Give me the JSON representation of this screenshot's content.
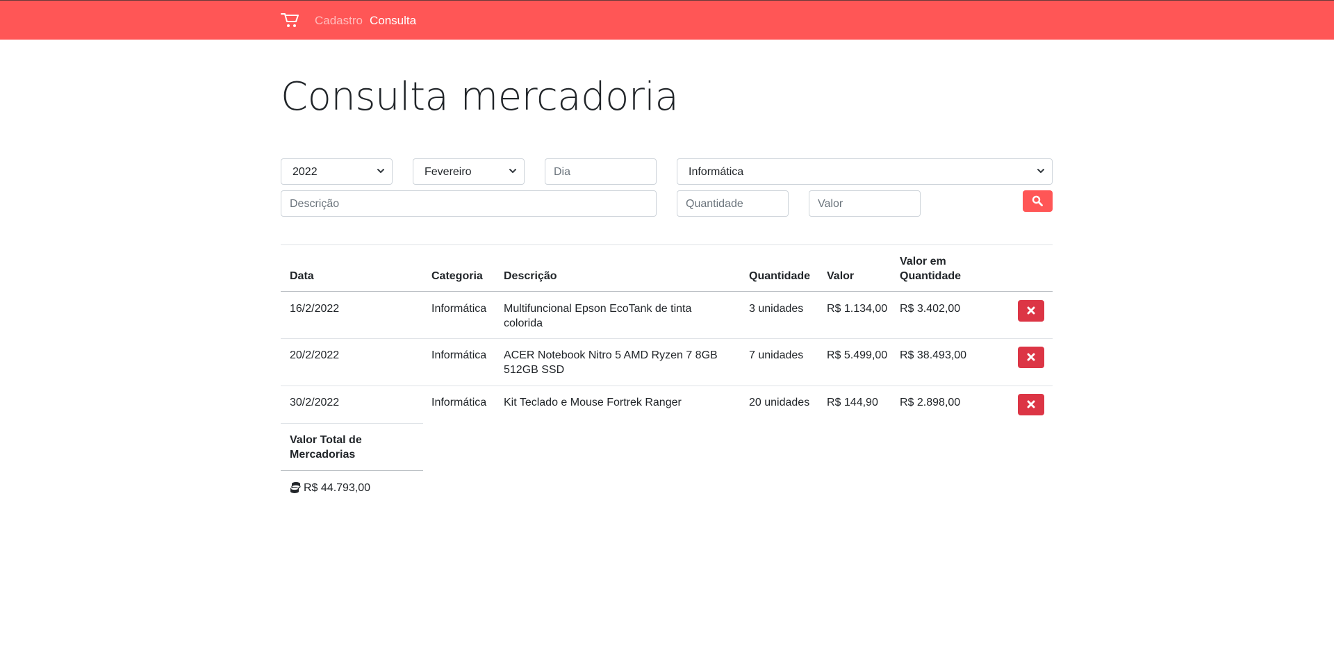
{
  "nav": {
    "brand_icon": "shopping-cart-icon",
    "links": [
      "Cadastro",
      "Consulta"
    ]
  },
  "page": {
    "title": "Consulta mercadoria"
  },
  "filters": {
    "year": "2022",
    "month": "Fevereiro",
    "day_placeholder": "Dia",
    "category": "Informática",
    "description_placeholder": "Descrição",
    "quantity_placeholder": "Quantidade",
    "value_placeholder": "Valor",
    "search_icon": "search-icon"
  },
  "table": {
    "headers": {
      "data": "Data",
      "categoria": "Categoria",
      "descricao": "Descrição",
      "quantidade": "Quantidade",
      "valor": "Valor",
      "valor_em_quantidade_1": "Valor em",
      "valor_em_quantidade_2": "Quantidade"
    },
    "rows": [
      {
        "data": "16/2/2022",
        "categoria": "Informática",
        "descricao_1": "Multifuncional Epson EcoTank de tinta",
        "descricao_2": "colorida",
        "quantidade": "3 unidades",
        "valor": "R$ 1.134,00",
        "valor_total": "R$ 3.402,00"
      },
      {
        "data": "20/2/2022",
        "categoria": "Informática",
        "descricao_1": "ACER Notebook Nitro 5 AMD Ryzen 7 8GB",
        "descricao_2": "512GB SSD",
        "quantidade": "7 unidades",
        "valor": "R$ 5.499,00",
        "valor_total": "R$ 38.493,00"
      },
      {
        "data": "30/2/2022",
        "categoria": "Informática",
        "descricao_1": "Kit Teclado e Mouse Fortrek Ranger",
        "descricao_2": "",
        "quantidade": "20 unidades",
        "valor": "R$ 144,90",
        "valor_total": "R$ 2.898,00"
      }
    ],
    "delete_icon": "close-icon"
  },
  "summary": {
    "label_1": "Valor Total de",
    "label_2": "Mercadorias",
    "icon": "coins-icon",
    "total": "R$ 44.793,00"
  },
  "colors": {
    "navbar": "#ff5656",
    "search_button": "#ff5656",
    "delete_button": "#dc3545"
  }
}
